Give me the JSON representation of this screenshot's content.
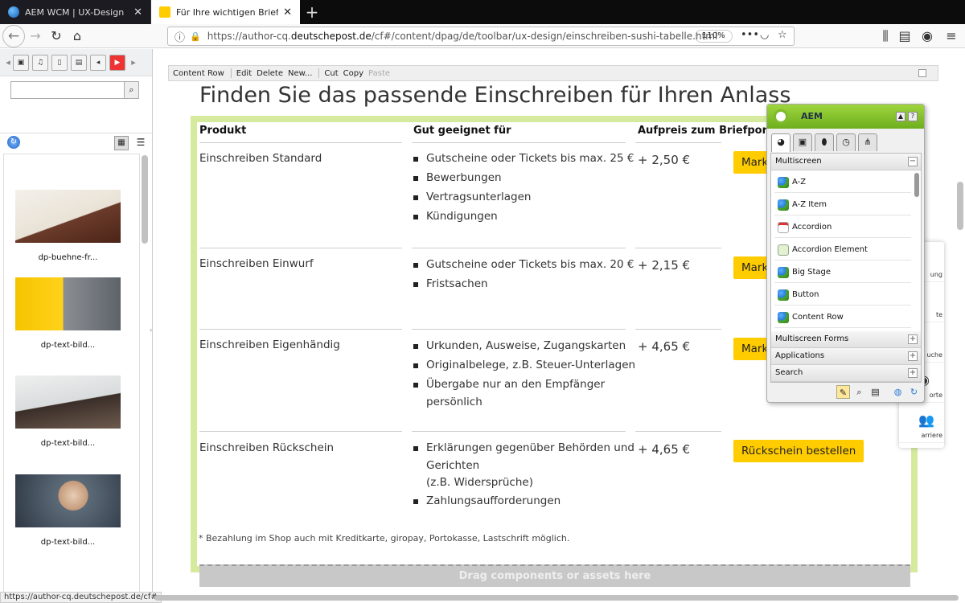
{
  "browser": {
    "tabs": [
      {
        "title": "AEM WCM | UX-Design"
      },
      {
        "title": "Für Ihre wichtigen Briefsendung"
      }
    ],
    "url_prefix": "https://author-cq.",
    "url_domain": "deutschepost.de",
    "url_path": "/cf#/content/dpag/de/toolbar/ux-design/einschreiben-sushi-tabelle.html",
    "zoom": "110%",
    "status_url": "https://author-cq.deutschepost.de/cf#"
  },
  "content_finder": {
    "assets": [
      {
        "caption": "dp-buehne-fr..."
      },
      {
        "caption": "dp-text-bild..."
      },
      {
        "caption": "dp-text-bild..."
      },
      {
        "caption": "dp-text-bild..."
      }
    ]
  },
  "edit_toolbar": {
    "content_row": "Content Row",
    "edit": "Edit",
    "delete": "Delete",
    "new": "New...",
    "cut": "Cut",
    "copy": "Copy",
    "paste": "Paste"
  },
  "page": {
    "title": "Finden Sie das passende Einschreiben für Ihren Anlass",
    "columns": [
      "Produkt",
      "Gut geeignet für",
      "Aufpreis zum Briefporto"
    ],
    "rows": [
      {
        "product": "Einschreiben Standard",
        "uses": [
          "Gutscheine oder Tickets bis max. 25 €",
          "Bewerbungen",
          "Vertragsunterlagen",
          "Kündigungen"
        ],
        "price": "+ 2,50 €",
        "button": "Mark"
      },
      {
        "product": "Einschreiben Einwurf",
        "uses": [
          "Gutscheine oder Tickets bis max. 20 €",
          "Fristsachen"
        ],
        "price": "+ 2,15 €",
        "button": "Mark"
      },
      {
        "product": "Einschreiben Eigenhändig",
        "uses": [
          "Urkunden, Ausweise, Zugangskarten",
          "Originalbelege, z.B. Steuer-Unterlagen",
          "Übergabe nur an den Empfänger",
          "persönlich"
        ],
        "price": "+ 4,65 €",
        "button": "Mark"
      },
      {
        "product": "Einschreiben Rückschein",
        "uses": [
          "Erklärungen gegenüber Behörden und",
          "Gerichten",
          "(z.B. Widersprüche)",
          "Zahlungsaufforderungen"
        ],
        "price": "+ 4,65 €",
        "button": "Rückschein bestellen"
      }
    ],
    "footnote": "* Bezahlung im Shop auch mit Kreditkarte, giropay, Portokasse, Lastschrift möglich.",
    "dropzone": "Drag components or assets here"
  },
  "side_toolbar": [
    "ung",
    "te",
    "uche",
    "orte",
    "arriere"
  ],
  "sidekick": {
    "title": "AEM",
    "sections": {
      "multiscreen": "Multiscreen",
      "multiscreen_forms": "Multiscreen Forms",
      "applications": "Applications",
      "search": "Search"
    },
    "components": [
      "A-Z",
      "A-Z Item",
      "Accordion",
      "Accordion Element",
      "Big Stage",
      "Button",
      "Content Row"
    ]
  },
  "colors": {
    "accent_yellow": "#ffcc00",
    "frame_green": "#d6ea9e",
    "sidekick_green": "#7dbb2b"
  }
}
